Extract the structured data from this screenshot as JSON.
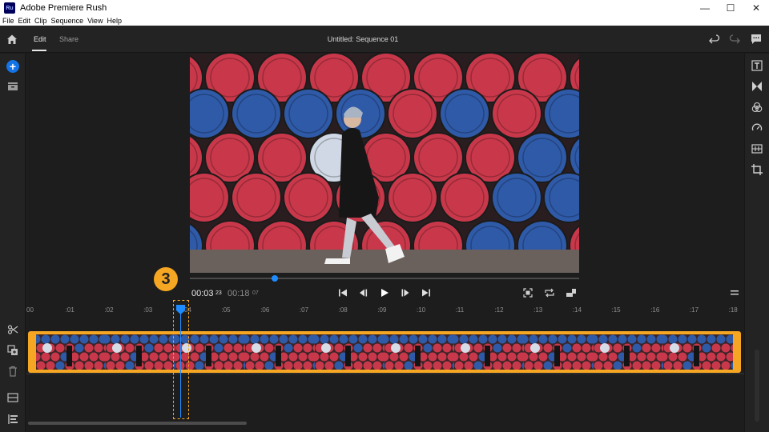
{
  "window": {
    "title": "Adobe Premiere Rush",
    "logo_text": "Ru",
    "controls": [
      "—",
      "☐",
      "✕"
    ]
  },
  "menu": [
    "File",
    "Edit",
    "Clip",
    "Sequence",
    "View",
    "Help"
  ],
  "header": {
    "tabs": [
      "Edit",
      "Share"
    ],
    "active_tab": "Edit",
    "sequence_title": "Untitled: Sequence 01",
    "icons": [
      "home-icon",
      "undo-icon",
      "redo-icon",
      "feedback-icon"
    ]
  },
  "left_tools": [
    "add-media-icon",
    "project-assets-icon",
    "split-clip-icon",
    "duplicate-icon",
    "delete-icon",
    "track-controls-icon",
    "track-list-icon"
  ],
  "right_tools": [
    "titles-icon",
    "transitions-icon",
    "color-icon",
    "speed-icon",
    "audio-icon",
    "transform-icon"
  ],
  "transport": {
    "current_time": "00:03",
    "current_frames": "23",
    "duration": "00:18",
    "duration_frames": "07",
    "buttons": [
      "go-to-start-icon",
      "step-back-icon",
      "play-icon",
      "step-forward-icon",
      "go-to-end-icon"
    ],
    "view_buttons": [
      "fit-icon",
      "loop-icon",
      "aspect-icon"
    ],
    "scrub_position": 0.21
  },
  "ruler": {
    "labels": [
      "00",
      ":01",
      ":02",
      ":03",
      ":04",
      ":05",
      ":06",
      ":07",
      ":08",
      ":09",
      ":10",
      ":11",
      ":12",
      ":13",
      ":14",
      ":15",
      ":16",
      ":17",
      ":18"
    ]
  },
  "annotation": {
    "step_number": "3"
  },
  "colors": {
    "accent_blue": "#1e8cff",
    "clip_orange": "#f5a623",
    "barrel_red": "#c8384a",
    "barrel_blue": "#2f5aa8"
  }
}
